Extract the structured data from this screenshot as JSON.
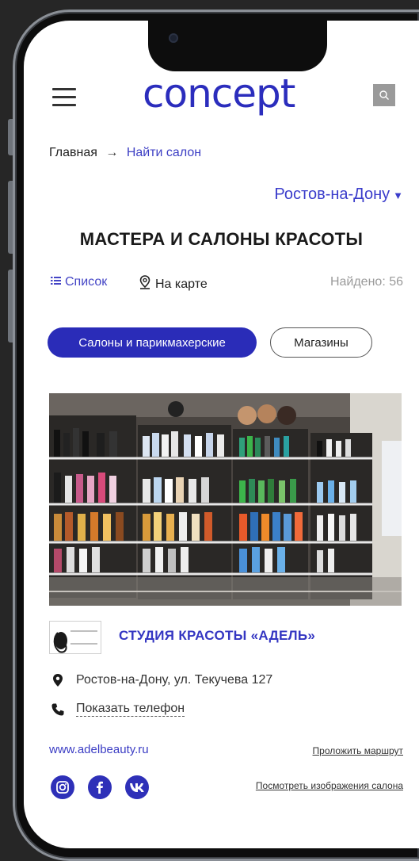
{
  "header": {
    "logo_text": "concept",
    "menu_icon": "hamburger-menu-icon",
    "search_icon": "search-icon"
  },
  "breadcrumb": {
    "home": "Главная",
    "separator": "→",
    "current": "Найти салон"
  },
  "city_selector": {
    "value": "Ростов-на-Дону",
    "caret": "▼"
  },
  "page_title": "МАСТЕРА И САЛОНЫ КРАСОТЫ",
  "view_toggle": {
    "list_label": "Список",
    "map_label": "На карте",
    "found_text": "Найдено: 56"
  },
  "filters": [
    {
      "label": "Салоны и парикмахерские",
      "active": true
    },
    {
      "label": "Магазины",
      "active": false
    }
  ],
  "salon": {
    "logo_text": "ADEL BEAUTY",
    "name": "СТУДИЯ КРАСОТЫ «АДЕЛЬ»",
    "address": "Ростов-на-Дону, ул. Текучева 127",
    "phone_label": "Показать телефон",
    "website": "www.adelbeauty.ru",
    "route_label": "Проложить маршрут",
    "gallery_label": "Посмотреть изображения салона",
    "socials": [
      "instagram-icon",
      "facebook-icon",
      "vk-icon"
    ]
  },
  "colors": {
    "brand": "#2b2dbd",
    "link": "#3a3cc4",
    "muted": "#9a9a9a"
  }
}
